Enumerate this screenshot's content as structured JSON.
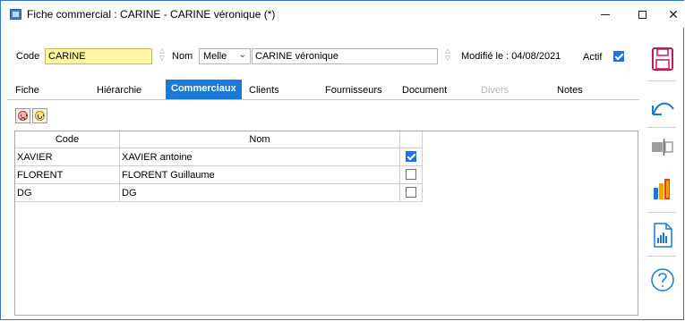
{
  "window": {
    "title": "Fiche commercial : CARINE - CARINE véronique (*)",
    "controls": {
      "close_glyph": "✕"
    }
  },
  "header": {
    "code_label": "Code",
    "code_value": "CARINE",
    "nom_label": "Nom",
    "civilite_value": "Melle",
    "name_value": "CARINE véronique",
    "modified_text": "Modifié le : 04/08/2021",
    "actif_label": "Actif",
    "actif_checked": true
  },
  "tabs": [
    {
      "label": "Fiche",
      "active": false,
      "disabled": false
    },
    {
      "label": "Hiérarchie",
      "active": false,
      "disabled": false
    },
    {
      "label": "Commerciaux",
      "active": true,
      "disabled": false
    },
    {
      "label": "Clients",
      "active": false,
      "disabled": false
    },
    {
      "label": "Fournisseurs",
      "active": false,
      "disabled": false
    },
    {
      "label": "Document",
      "active": false,
      "disabled": false
    },
    {
      "label": "Divers",
      "active": false,
      "disabled": true
    },
    {
      "label": "Notes",
      "active": false,
      "disabled": false
    }
  ],
  "grid": {
    "columns": [
      "Code",
      "Nom"
    ],
    "rows": [
      {
        "code": "XAVIER",
        "nom": "XAVIER antoine",
        "checked": true
      },
      {
        "code": "FLORENT",
        "nom": "FLORENT Guillaume",
        "checked": false
      },
      {
        "code": "DG",
        "nom": "DG",
        "checked": false
      }
    ]
  },
  "toolbar": {
    "icons": [
      "sad-face-icon",
      "happy-face-icon"
    ]
  },
  "sidebar": {
    "icons": [
      "save-icon",
      "undo-icon",
      "columns-icon",
      "bar-chart-icon",
      "report-chart-icon",
      "help-icon"
    ]
  },
  "colors": {
    "accent": "#1a7ad6",
    "code_field_bg": "#fff7a3",
    "window_border": "#2b79d0"
  }
}
